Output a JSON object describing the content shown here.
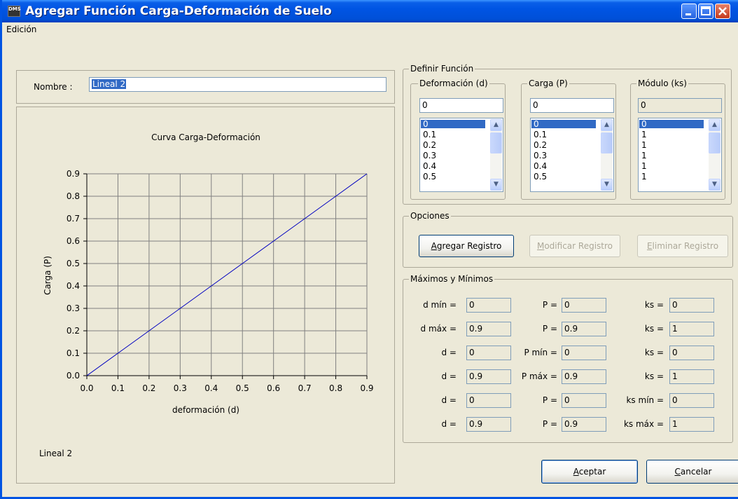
{
  "window": {
    "title": "Agregar Función Carga-Deformación de Suelo",
    "icon_text": "DMS"
  },
  "menu": {
    "items": [
      "Edición"
    ]
  },
  "nombre": {
    "label": "Nombre :",
    "value": "Lineal 2"
  },
  "chart_data": {
    "type": "line",
    "title": "Curva Carga-Deformación",
    "xlabel": "deformación (d)",
    "ylabel": "Carga (P)",
    "xlim": [
      0,
      0.9
    ],
    "ylim": [
      0,
      0.9
    ],
    "x_ticks": [
      "0.0",
      "0.1",
      "0.2",
      "0.3",
      "0.4",
      "0.5",
      "0.6",
      "0.7",
      "0.8",
      "0.9"
    ],
    "y_ticks": [
      "0.0",
      "0.1",
      "0.2",
      "0.3",
      "0.4",
      "0.5",
      "0.6",
      "0.7",
      "0.8",
      "0.9"
    ],
    "grid": true,
    "series": [
      {
        "x": [
          0,
          0.1,
          0.2,
          0.3,
          0.4,
          0.5,
          0.6,
          0.7,
          0.8,
          0.9
        ],
        "y": [
          0,
          0.1,
          0.2,
          0.3,
          0.4,
          0.5,
          0.6,
          0.7,
          0.8,
          0.9
        ],
        "color": "#0000c0"
      }
    ],
    "footer_label": "Lineal 2"
  },
  "definir": {
    "title": "Definir Función",
    "deformacion": {
      "title": "Deformación (d)",
      "input": "0",
      "items": [
        "0",
        "0.1",
        "0.2",
        "0.3",
        "0.4",
        "0.5"
      ]
    },
    "carga": {
      "title": "Carga (P)",
      "input": "0",
      "items": [
        "0",
        "0.1",
        "0.2",
        "0.3",
        "0.4",
        "0.5"
      ]
    },
    "modulo": {
      "title": "Módulo (ks)",
      "input": "0",
      "items": [
        "0",
        "1",
        "1",
        "1",
        "1",
        "1"
      ]
    }
  },
  "opciones": {
    "title": "Opciones",
    "agregar": {
      "pre": "",
      "ul": "A",
      "rest": "gregar Registro"
    },
    "modificar": {
      "pre": "",
      "ul": "M",
      "rest": "odificar Registro"
    },
    "eliminar": {
      "pre": "",
      "ul": "E",
      "rest": "liminar Registro"
    }
  },
  "maxmin": {
    "title": "Máximos y Mínimos",
    "rows": [
      {
        "l1": "d mín =",
        "v1": "0",
        "l2": "P =",
        "v2": "0",
        "l3": "ks =",
        "v3": "0"
      },
      {
        "l1": "d máx =",
        "v1": "0.9",
        "l2": "P =",
        "v2": "0.9",
        "l3": "ks =",
        "v3": "1"
      },
      {
        "l1": "d =",
        "v1": "0",
        "l2": "P mín =",
        "v2": "0",
        "l3": "ks =",
        "v3": "0"
      },
      {
        "l1": "d =",
        "v1": "0.9",
        "l2": "P máx =",
        "v2": "0.9",
        "l3": "ks =",
        "v3": "1"
      },
      {
        "l1": "d =",
        "v1": "0",
        "l2": "P =",
        "v2": "0",
        "l3": "ks mín =",
        "v3": "0"
      },
      {
        "l1": "d =",
        "v1": "0.9",
        "l2": "P =",
        "v2": "0.9",
        "l3": "ks máx =",
        "v3": "1"
      }
    ]
  },
  "buttons": {
    "aceptar": {
      "ul": "A",
      "rest": "ceptar"
    },
    "cancelar": {
      "ul": "C",
      "rest": "ancelar"
    }
  }
}
